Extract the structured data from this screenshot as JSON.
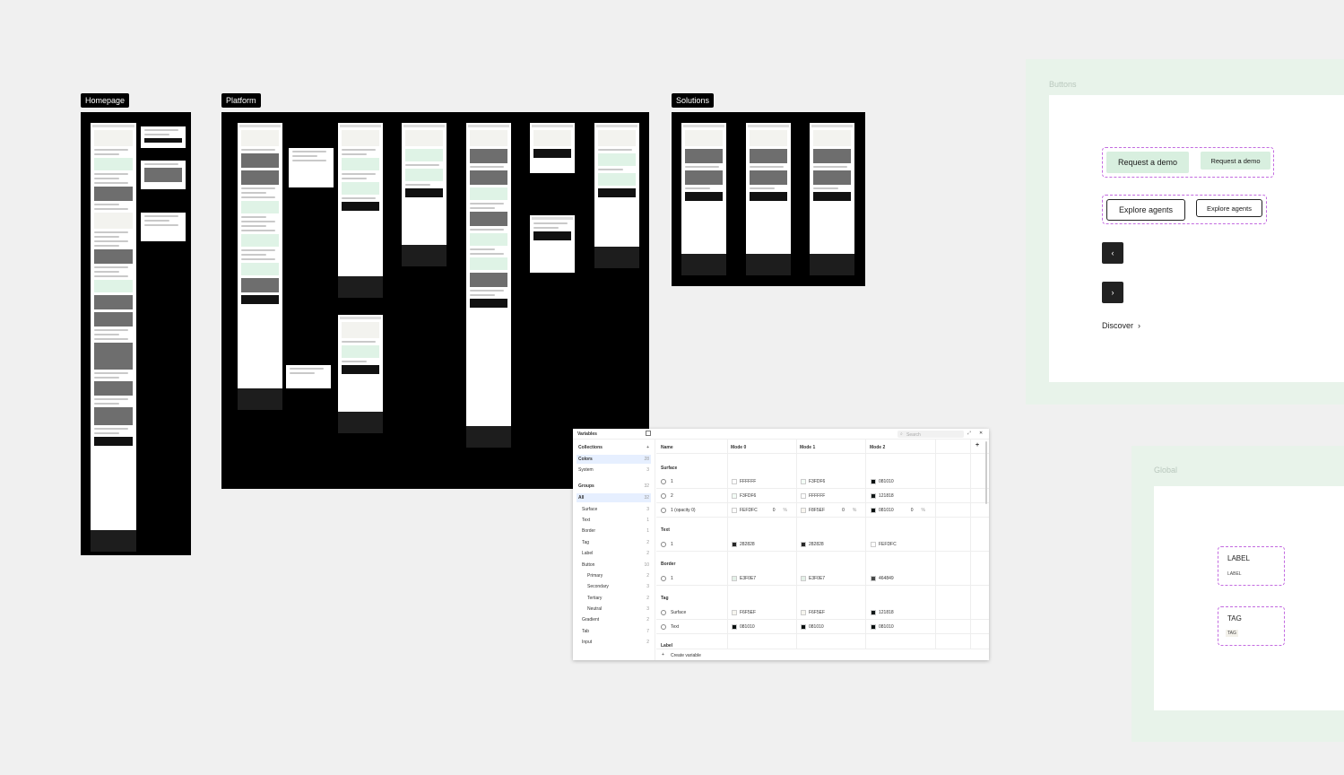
{
  "frames": {
    "homepage": "Homepage",
    "platform": "Platform",
    "solutions": "Solutions"
  },
  "buttons_panel": {
    "title": "Buttons",
    "request_demo_primary": "Request a demo",
    "request_demo_secondary": "Request a demo",
    "explore_agents_primary": "Explore agents",
    "explore_agents_secondary": "Explore agents",
    "prev": "‹",
    "next": "›",
    "discover": "Discover",
    "discover_chevron": "›"
  },
  "global_panel": {
    "title": "Global",
    "label_large": "LABEL",
    "label_small": "LABEL",
    "tag_large": "TAG",
    "tag_small": "TAG"
  },
  "variables": {
    "title": "Variables",
    "search_placeholder": "Search",
    "collections_label": "Collections",
    "collections": [
      {
        "name": "Colors",
        "count": "28"
      },
      {
        "name": "System",
        "count": "3"
      }
    ],
    "groups_label": "Groups",
    "groups": [
      {
        "name": "All",
        "count": "32"
      },
      {
        "name": "Surface",
        "count": "3"
      },
      {
        "name": "Text",
        "count": "1"
      },
      {
        "name": "Border",
        "count": "1"
      },
      {
        "name": "Tag",
        "count": "2"
      },
      {
        "name": "Label",
        "count": "2"
      },
      {
        "name": "Button",
        "count": "10"
      },
      {
        "name": "Primary",
        "count": "2"
      },
      {
        "name": "Secondary",
        "count": "3"
      },
      {
        "name": "Tertiary",
        "count": "2"
      },
      {
        "name": "Neutral",
        "count": "3"
      },
      {
        "name": "Gradient",
        "count": "2"
      },
      {
        "name": "Tab",
        "count": "7"
      },
      {
        "name": "Input",
        "count": "2"
      }
    ],
    "columns": {
      "name": "Name",
      "mode0": "Mode 0",
      "mode1": "Mode 1",
      "mode2": "Mode 2"
    },
    "add_col": "+",
    "sections": [
      {
        "title": "Surface",
        "rows": [
          {
            "name": "1",
            "m0": "FFFFFF",
            "m0c": "#FFFFFF",
            "m1": "F3FDF6",
            "m1c": "#F3FDF6",
            "m2": "081010",
            "m2c": "#081010"
          },
          {
            "name": "2",
            "m0": "F3FDF6",
            "m0c": "#F3FDF6",
            "m1": "FFFFFF",
            "m1c": "#FFFFFF",
            "m2": "121818",
            "m2c": "#121818"
          },
          {
            "name": "1 (opacity 0)",
            "m0": "FEFDFC",
            "m0c": "#FEFDFC",
            "m0p": "0",
            "m1": "F8F5EF",
            "m1c": "#F8F5EF",
            "m1p": "0",
            "m2": "081010",
            "m2c": "#081010",
            "m2p": "0"
          }
        ]
      },
      {
        "title": "Text",
        "rows": [
          {
            "name": "1",
            "m0": "282828",
            "m0c": "#282828",
            "m1": "282828",
            "m1c": "#282828",
            "m2": "FEFDFC",
            "m2c": "#FEFDFC"
          }
        ]
      },
      {
        "title": "Border",
        "rows": [
          {
            "name": "1",
            "m0": "E3F0E7",
            "m0c": "#E3F0E7",
            "m1": "E3F0E7",
            "m1c": "#E3F0E7",
            "m2": "464849",
            "m2c": "#464849"
          }
        ]
      },
      {
        "title": "Tag",
        "rows": [
          {
            "name": "Surface",
            "m0": "F6F5EF",
            "m0c": "#F6F5EF",
            "m1": "F6F5EF",
            "m1c": "#F6F5EF",
            "m2": "121818",
            "m2c": "#121818"
          },
          {
            "name": "Text",
            "m0": "081010",
            "m0c": "#081010",
            "m1": "081010",
            "m1c": "#081010",
            "m2": "081010",
            "m2c": "#081010"
          }
        ]
      }
    ],
    "next_section": "Label",
    "create_variable": "Create variable"
  },
  "colors": {
    "canvas": "#f0f0f0",
    "frame": "#000000",
    "accent_mint": "#d8efdf",
    "selection_dash": "#c36be0"
  }
}
